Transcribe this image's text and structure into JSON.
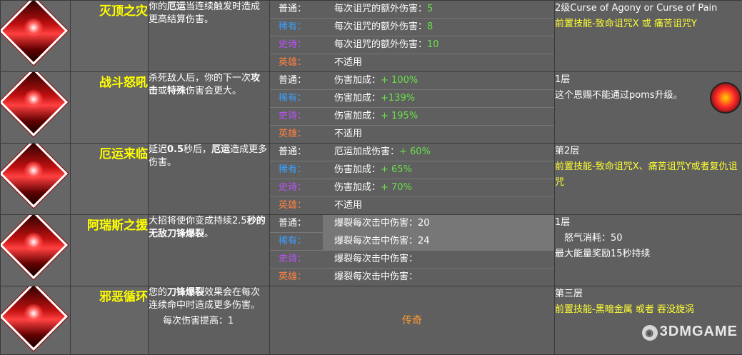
{
  "rarity_labels": {
    "common": "普通：",
    "rare": "稀有：",
    "epic": "史诗：",
    "heroic": "英雄："
  },
  "rows": [
    {
      "name": "灭顶之灾",
      "desc_html": "你的<b>厄运</b>当连续触发时造成更高结算伤害。",
      "rarity": [
        {
          "text": "每次诅咒的额外伤害：",
          "value": "5"
        },
        {
          "text": "每次诅咒的额外伤害：",
          "value": "8"
        },
        {
          "text": "每次诅咒的额外伤害：",
          "value": "10"
        },
        {
          "text": "不适用",
          "value": ""
        }
      ],
      "req_lines": [
        {
          "text": "2级Curse of Agony or Curse of Pain",
          "color": "white"
        },
        {
          "prefix": "前置技能-",
          "text": "致命诅咒X 或 痛苦诅咒Y",
          "color": "yellow"
        }
      ]
    },
    {
      "name": "战斗怒吼",
      "desc_html": "杀死敌人后，你的下一次<b>攻击</b>或<b>特殊</b>伤害会更大。",
      "rarity": [
        {
          "text": "伤害加成：",
          "value": "+ 100%"
        },
        {
          "text": "伤害加成：",
          "value": "+139%"
        },
        {
          "text": "伤害加成：",
          "value": "+ 195%"
        },
        {
          "text": "不适用",
          "value": ""
        }
      ],
      "req_lines": [
        {
          "text": "1层",
          "color": "white"
        },
        {
          "text": "这个恩赐不能通过poms升级。",
          "color": "white"
        }
      ]
    },
    {
      "name": "厄运来临",
      "desc_html": "延迟<b>0.5</b>秒后，<b>厄运</b>造成更多伤害。",
      "rarity": [
        {
          "text": "厄运加成伤害：",
          "value": "+ 60%"
        },
        {
          "text": "伤害加成：",
          "value": "+ 65%"
        },
        {
          "text": "伤害加成：",
          "value": "+ 70%"
        },
        {
          "text": "不适用",
          "value": ""
        }
      ],
      "req_lines": [
        {
          "text": "第2层",
          "color": "white"
        },
        {
          "text": "前置技能-致命诅咒X、痛苦诅咒Y或者复仇诅咒",
          "color": "yellow"
        }
      ]
    },
    {
      "name": "阿瑞斯之援",
      "desc_html": "大招将使你变成持续2.5<b>秒的无敌刀锋爆裂</b>。",
      "rarity": [
        {
          "text": "爆裂每次击中伤害：",
          "value": "20"
        },
        {
          "text": "爆裂每次击中伤害：",
          "value": "24"
        },
        {
          "text": "爆裂每次击中伤害：",
          "value": ""
        },
        {
          "text": "爆裂每次击中伤害：",
          "value": ""
        }
      ],
      "req_lines": [
        {
          "text": "1层",
          "color": "white"
        },
        {
          "text": "　怒气消耗：50",
          "color": "white"
        },
        {
          "text": "最大能量奖励15秒持续",
          "color": "white"
        }
      ]
    },
    {
      "name": "邪恶循环",
      "desc_html": "您的<b>刀锋爆裂</b>效果会在每次连续命中时造成更多伤害。",
      "extra": "每次伤害提高：1",
      "legendary": "传奇",
      "req_lines": [
        {
          "text": "第三层",
          "color": "white"
        },
        {
          "text": "前置技能-黑暗金属 或者 吞没旋涡",
          "color": "yellow"
        }
      ]
    }
  ],
  "watermark": "3DMGAME",
  "colors": {
    "common": "#ffffff",
    "rare": "#3aa0ff",
    "epic": "#c050ff",
    "heroic": "#ff8040",
    "value": "#6adf4a",
    "name": "#ffff00"
  }
}
